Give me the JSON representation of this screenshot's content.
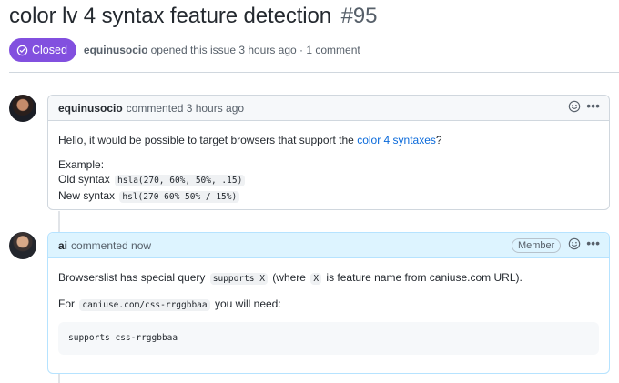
{
  "issue": {
    "title": "color lv 4 syntax feature detection",
    "number": "#95",
    "state": "Closed",
    "author": "equinusocio",
    "opened_text": "opened this issue 3 hours ago · 1 comment"
  },
  "comments": [
    {
      "author": "equinusocio",
      "time_text": "commented 3 hours ago",
      "body": {
        "line1_pre": "Hello, it would be possible to target browsers that support the",
        "line1_link": "color 4 syntaxes",
        "line1_post": "?",
        "example_label": "Example:",
        "old_label": "Old syntax",
        "old_code": "hsla(270, 60%, 50%, .15)",
        "new_label": "New syntax",
        "new_code": "hsl(270 60% 50% / 15%)"
      }
    },
    {
      "author": "ai",
      "time_text": "commented now",
      "badge": "Member",
      "body": {
        "p1_pre": "Browserslist has special query",
        "p1_code1": "supports X",
        "p1_mid": "(where",
        "p1_code2": "X",
        "p1_post": "is feature name from caniuse.com URL).",
        "p2_pre": "For",
        "p2_code": "caniuse.com/css-rrggbbaa",
        "p2_post": "you will need:",
        "codeblock": "supports css-rrggbbaa"
      }
    }
  ],
  "icons": {
    "state": "issue-closed-icon",
    "reaction": "smiley-icon",
    "menu": "kebab-horizontal-icon"
  },
  "colors": {
    "closed_badge": "#8250df",
    "link": "#0969da",
    "member_header": "#ddf4ff"
  }
}
